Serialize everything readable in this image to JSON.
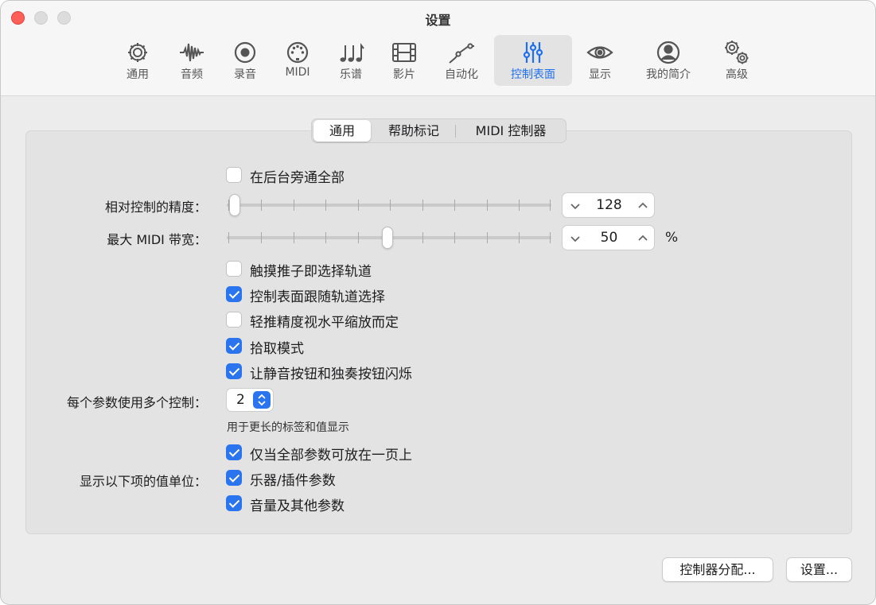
{
  "window": {
    "title": "设置"
  },
  "toolbar": {
    "tabs": [
      {
        "label": "通用",
        "icon": "gear-icon"
      },
      {
        "label": "音频",
        "icon": "waveform-icon"
      },
      {
        "label": "录音",
        "icon": "record-icon"
      },
      {
        "label": "MIDI",
        "icon": "midi-port-icon"
      },
      {
        "label": "乐谱",
        "icon": "music-notes-icon"
      },
      {
        "label": "影片",
        "icon": "film-icon"
      },
      {
        "label": "自动化",
        "icon": "automation-curve-icon"
      },
      {
        "label": "控制表面",
        "icon": "sliders-icon"
      },
      {
        "label": "显示",
        "icon": "eye-icon"
      },
      {
        "label": "我的简介",
        "icon": "person-icon"
      },
      {
        "label": "高级",
        "icon": "gears-icon"
      }
    ],
    "active_tab": "控制表面",
    "accent_color": "#1f6ff0"
  },
  "subtabs": {
    "items": [
      "通用",
      "帮助标记",
      "MIDI 控制器"
    ],
    "active": "通用"
  },
  "settings": {
    "bypass_all": {
      "label": "在后台旁通全部",
      "checked": false
    },
    "precision": {
      "label": "相对控制的精度：",
      "value": "128"
    },
    "bandwidth": {
      "label": "最大 MIDI 带宽：",
      "value": "50",
      "unit": "%"
    },
    "touch_fader": {
      "label": "触摸推子即选择轨道",
      "checked": false
    },
    "follow_track": {
      "label": "控制表面跟随轨道选择",
      "checked": true
    },
    "nudge_zoom": {
      "label": "轻推精度视水平缩放而定",
      "checked": false
    },
    "pickup_mode": {
      "label": "拾取模式",
      "checked": true
    },
    "blink_buttons": {
      "label": "让静音按钮和独奏按钮闪烁",
      "checked": true
    },
    "multi_control": {
      "label": "每个参数使用多个控制：",
      "value": "2",
      "hint": "用于更长的标签和值显示"
    },
    "value_units": {
      "label": "显示以下项的值单位：",
      "only_all_fit": {
        "label": "仅当全部参数可放在一页上",
        "checked": true
      },
      "instrument": {
        "label": "乐器/插件参数",
        "checked": true
      },
      "volume": {
        "label": "音量及其他参数",
        "checked": true
      }
    }
  },
  "footer": {
    "assign_button": "控制器分配...",
    "setup_button": "设置..."
  }
}
